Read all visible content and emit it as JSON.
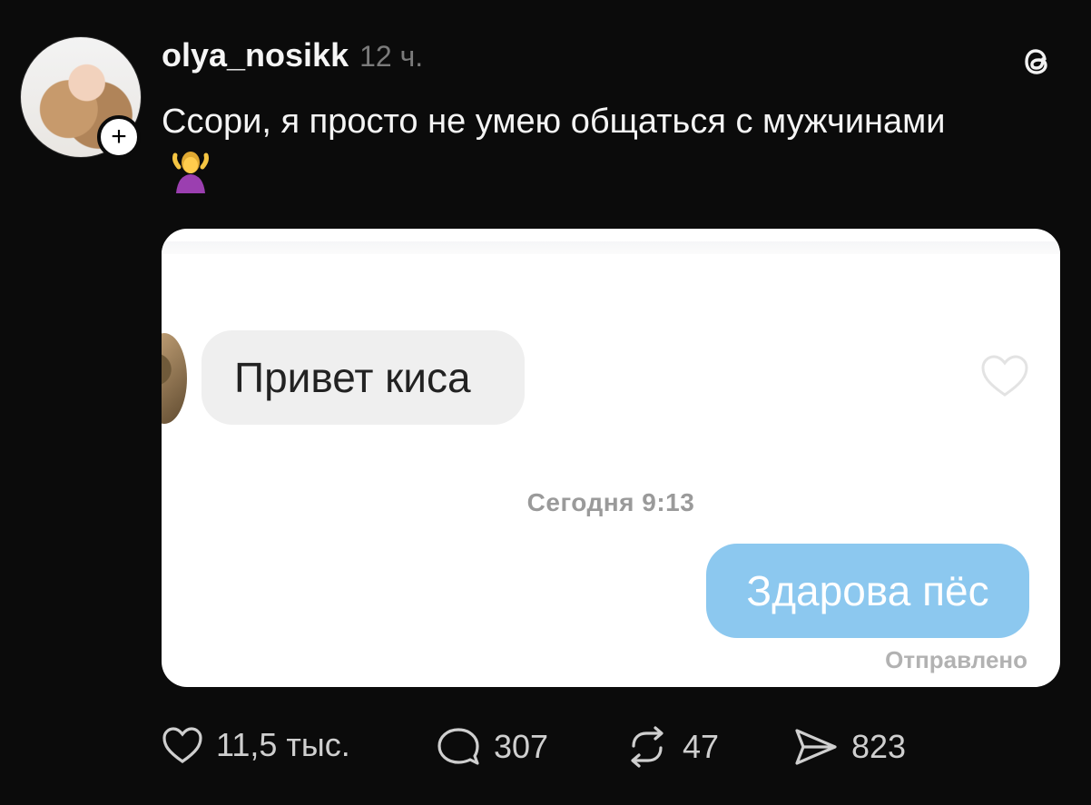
{
  "post": {
    "username": "olya_nosikk",
    "time": "12 ч.",
    "text": "Ссори, я просто не умею общаться с мужчинами",
    "emoji": "person-shrugging",
    "follow_icon": "+"
  },
  "screenshot": {
    "incoming_message": "Привет киса",
    "timestamp": "Сегодня 9:13",
    "outgoing_message": "Здарова пёс",
    "status": "Отправлено"
  },
  "actions": {
    "likes": "11,5 тыс.",
    "comments": "307",
    "reposts": "47",
    "shares": "823"
  },
  "colors": {
    "background": "#0b0b0b",
    "outgoing_bubble": "#8cc8ef",
    "incoming_bubble": "#efefef"
  }
}
